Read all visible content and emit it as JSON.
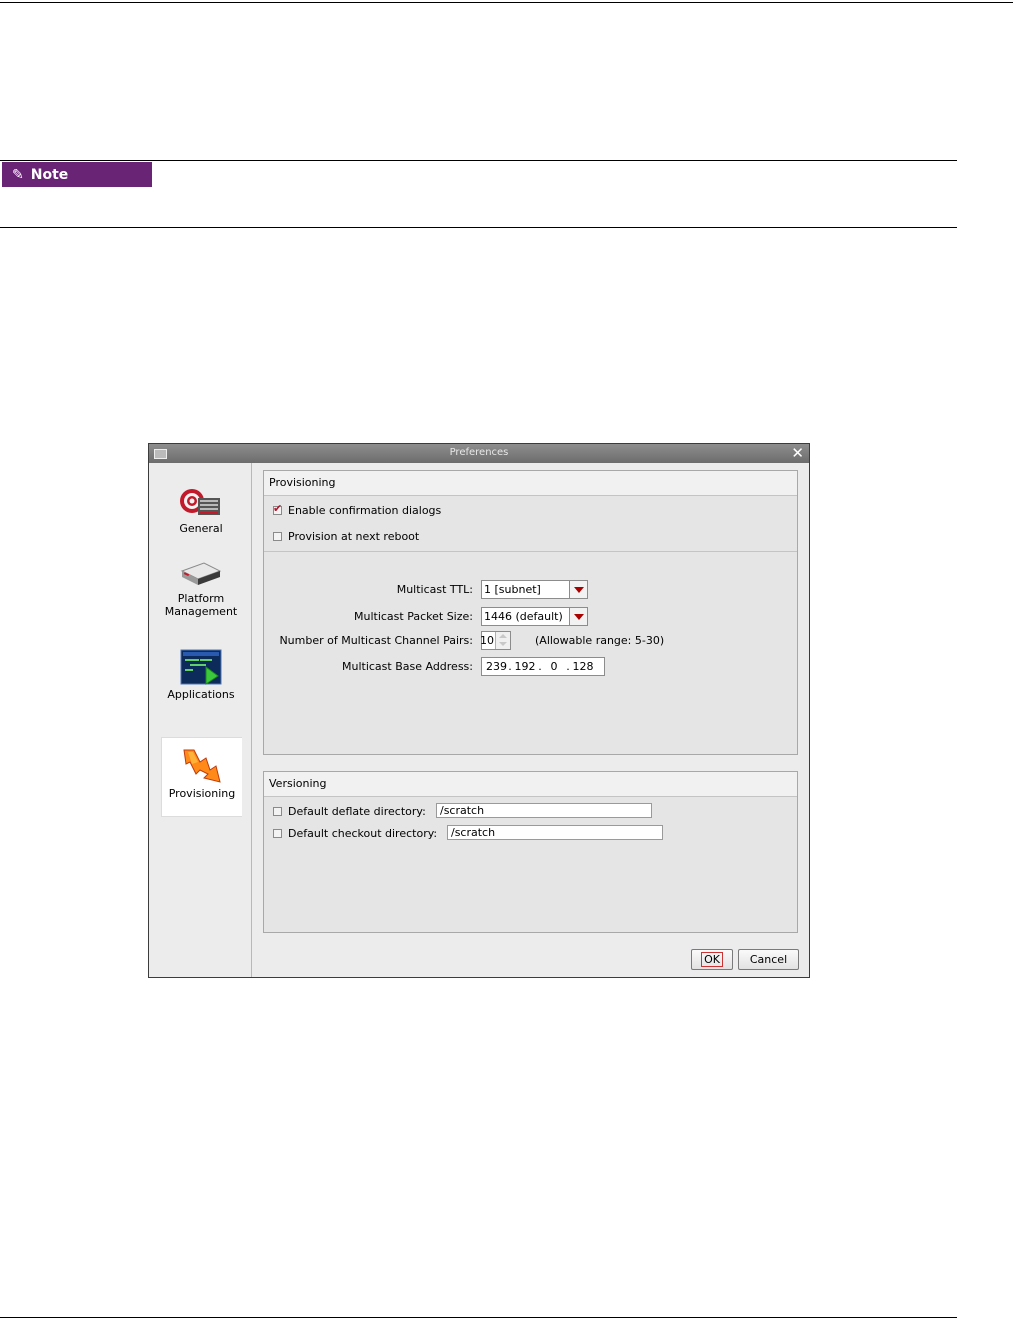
{
  "note": {
    "label": "Note"
  },
  "dialog": {
    "title": "Preferences",
    "close_glyph": "✕",
    "sidebar": {
      "items": [
        {
          "label": "General",
          "icon": "general-settings-icon"
        },
        {
          "label_line1": "Platform",
          "label_line2": "Management",
          "icon": "platform-hardware-icon"
        },
        {
          "label": "Applications",
          "icon": "applications-terminal-icon"
        },
        {
          "label": "Provisioning",
          "icon": "provisioning-arrow-icon",
          "selected": true
        }
      ]
    },
    "provisioning": {
      "header": "Provisioning",
      "enable_confirmation": {
        "label": "Enable confirmation dialogs",
        "checked": true
      },
      "provision_next_reboot": {
        "label": "Provision at next reboot",
        "checked": false
      },
      "multicast_ttl": {
        "label": "Multicast TTL:",
        "value": "1 [subnet]"
      },
      "packet_size": {
        "label": "Multicast Packet Size:",
        "value": "1446 (default)"
      },
      "channel_pairs": {
        "label": "Number of Multicast Channel Pairs:",
        "value": "10",
        "range_note": "(Allowable range: 5-30)"
      },
      "base_address": {
        "label": "Multicast Base Address:",
        "octets": [
          "239",
          "192",
          "0",
          "128"
        ]
      }
    },
    "versioning": {
      "header": "Versioning",
      "deflate_dir": {
        "label": "Default deflate directory:",
        "value": "/scratch",
        "checked": false
      },
      "checkout_dir": {
        "label": "Default checkout directory:",
        "value": "/scratch",
        "checked": false
      }
    },
    "buttons": {
      "ok": "OK",
      "cancel": "Cancel"
    }
  },
  "colors": {
    "note_badge": "#6a2476",
    "check_red": "#b4122a",
    "combo_arrow": "#aa0000"
  }
}
